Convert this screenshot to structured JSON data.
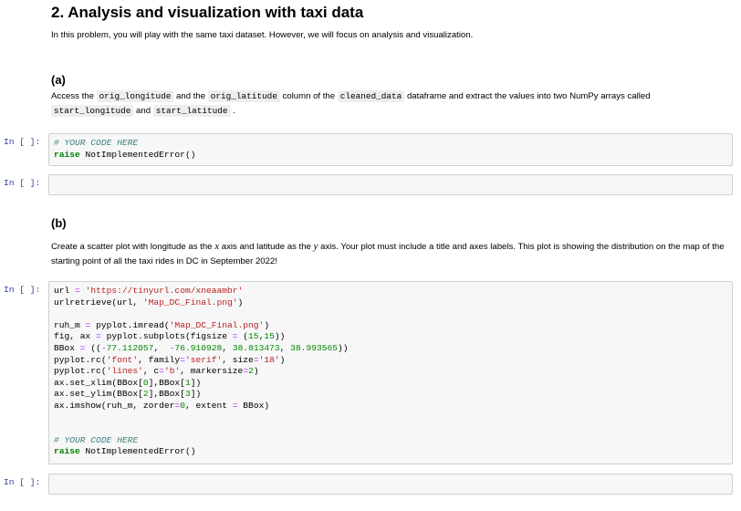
{
  "title": "2. Analysis and visualization with taxi data",
  "intro": "In this problem, you will play with the same taxi dataset. However, we will focus on analysis and visualization.",
  "part_a": {
    "heading": "(a)",
    "text": [
      {
        "t": "Access the "
      },
      {
        "code": "orig_longitude"
      },
      {
        "t": " and the "
      },
      {
        "code": "orig_latitude"
      },
      {
        "t": " column of the "
      },
      {
        "code": "cleaned_data"
      },
      {
        "t": " dataframe and extract the values into two NumPy arrays called "
      },
      {
        "code": "start_longitude"
      },
      {
        "t": " and "
      },
      {
        "code": "start_latitude"
      },
      {
        "t": " ."
      }
    ]
  },
  "part_b": {
    "heading": "(b)",
    "text": [
      {
        "t": "Create a scatter plot with longitude as the "
      },
      {
        "i": "x"
      },
      {
        "t": " axis and latitude as the "
      },
      {
        "i": "y"
      },
      {
        "t": " axis. Your plot must include a title and axes labels. This plot is showing the distribution on the map of the starting point of all the taxi rides in DC in September 2022!"
      }
    ]
  },
  "cells": [
    {
      "prompt": "In [ ]:",
      "lines": [
        [
          [
            "# YOUR CODE HERE",
            "c"
          ]
        ],
        [
          [
            "raise",
            "k"
          ],
          [
            " NotImplementedError()",
            ""
          ]
        ]
      ]
    },
    {
      "prompt": "In [ ]:",
      "lines": []
    },
    {
      "prompt": "In [ ]:",
      "lines": [
        [
          [
            "url ",
            ""
          ],
          [
            "=",
            "o"
          ],
          [
            " ",
            ""
          ],
          [
            "'https://tinyurl.com/xneaambr'",
            "s"
          ]
        ],
        [
          [
            "urlretrieve(url, ",
            ""
          ],
          [
            "'Map_DC_Final.png'",
            "s"
          ],
          [
            ")",
            ""
          ]
        ],
        [
          [
            "",
            ""
          ]
        ],
        [
          [
            "ruh_m ",
            ""
          ],
          [
            "=",
            "o"
          ],
          [
            " pyplot.imread(",
            ""
          ],
          [
            "'Map_DC_Final.png'",
            "s"
          ],
          [
            ")",
            ""
          ]
        ],
        [
          [
            "fig, ax ",
            ""
          ],
          [
            "=",
            "o"
          ],
          [
            " pyplot.subplots(figsize ",
            ""
          ],
          [
            "=",
            "o"
          ],
          [
            " (",
            ""
          ],
          [
            "15",
            "n"
          ],
          [
            ",",
            ""
          ],
          [
            "15",
            "n"
          ],
          [
            "))",
            ""
          ]
        ],
        [
          [
            "BBox ",
            ""
          ],
          [
            "=",
            "o"
          ],
          [
            " ((",
            ""
          ],
          [
            "-",
            "o"
          ],
          [
            "77.112057",
            "n"
          ],
          [
            ",  ",
            ""
          ],
          [
            "-",
            "o"
          ],
          [
            "76.910928",
            "n"
          ],
          [
            ", ",
            ""
          ],
          [
            "38.813473",
            "n"
          ],
          [
            ", ",
            ""
          ],
          [
            "38.993565",
            "n"
          ],
          [
            "))",
            ""
          ]
        ],
        [
          [
            "pyplot.rc(",
            ""
          ],
          [
            "'font'",
            "s"
          ],
          [
            ", family",
            ""
          ],
          [
            "=",
            "o"
          ],
          [
            "'serif'",
            "s"
          ],
          [
            ", size",
            ""
          ],
          [
            "=",
            "o"
          ],
          [
            "'18'",
            "s"
          ],
          [
            ")",
            ""
          ]
        ],
        [
          [
            "pyplot.rc(",
            ""
          ],
          [
            "'lines'",
            "s"
          ],
          [
            ", c",
            ""
          ],
          [
            "=",
            "o"
          ],
          [
            "'b'",
            "s"
          ],
          [
            ", markersize",
            ""
          ],
          [
            "=",
            "o"
          ],
          [
            "2",
            "n"
          ],
          [
            ")",
            ""
          ]
        ],
        [
          [
            "ax.set_xlim(BBox[",
            ""
          ],
          [
            "0",
            "n"
          ],
          [
            "],BBox[",
            ""
          ],
          [
            "1",
            "n"
          ],
          [
            "])",
            ""
          ]
        ],
        [
          [
            "ax.set_ylim(BBox[",
            ""
          ],
          [
            "2",
            "n"
          ],
          [
            "],BBox[",
            ""
          ],
          [
            "3",
            "n"
          ],
          [
            "])",
            ""
          ]
        ],
        [
          [
            "ax.imshow(ruh_m, zorder",
            ""
          ],
          [
            "=",
            "o"
          ],
          [
            "0",
            "n"
          ],
          [
            ", extent ",
            ""
          ],
          [
            "=",
            "o"
          ],
          [
            " BBox)",
            ""
          ]
        ],
        [
          [
            "",
            ""
          ]
        ],
        [
          [
            "",
            ""
          ]
        ],
        [
          [
            "# YOUR CODE HERE",
            "c"
          ]
        ],
        [
          [
            "raise",
            "k"
          ],
          [
            " NotImplementedError()",
            ""
          ]
        ]
      ]
    },
    {
      "prompt": "In [ ]:",
      "lines": []
    }
  ]
}
